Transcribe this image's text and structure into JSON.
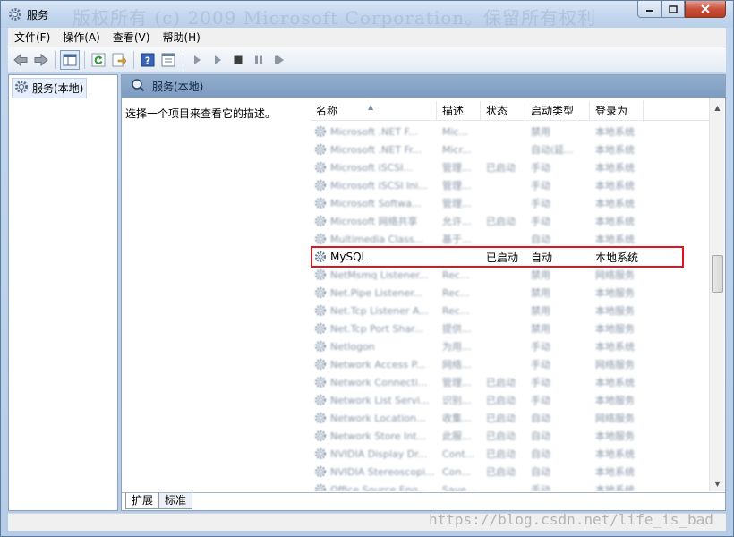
{
  "window": {
    "title": "服务",
    "watermark_top": "版权所有 (c) 2009 Microsoft Corporation。保留所有权利"
  },
  "menubar": {
    "items": [
      "文件(F)",
      "操作(A)",
      "查看(V)",
      "帮助(H)"
    ]
  },
  "toolbar": {
    "icons": [
      "back-arrow-icon",
      "forward-arrow-icon",
      "show-hide-tree-icon",
      "refresh-icon",
      "export-icon",
      "help-icon",
      "properties-icon",
      "start-service-icon",
      "start-service-alt-icon",
      "stop-service-icon",
      "pause-service-icon",
      "restart-service-icon"
    ]
  },
  "tree": {
    "root_label": "服务(本地)"
  },
  "main": {
    "header": "服务(本地)",
    "description_hint": "选择一个项目来查看它的描述。",
    "columns": {
      "name": "名称",
      "description": "描述",
      "status": "状态",
      "startup": "启动类型",
      "logon": "登录为"
    },
    "blurred_rows_before": [
      {
        "name": "Microsoft .NET F...",
        "desc": "Mic...",
        "status": "",
        "startup": "禁用",
        "logon": "本地系统"
      },
      {
        "name": "Microsoft .NET Fr...",
        "desc": "Micr...",
        "status": "",
        "startup": "自动(延...",
        "logon": "本地系统"
      },
      {
        "name": "Microsoft iSCSI...",
        "desc": "管理...",
        "status": "已启动",
        "startup": "手动",
        "logon": "本地系统"
      },
      {
        "name": "Microsoft iSCSI Ini...",
        "desc": "管理...",
        "status": "",
        "startup": "手动",
        "logon": "本地系统"
      },
      {
        "name": "Microsoft Softwa...",
        "desc": "管理...",
        "status": "",
        "startup": "手动",
        "logon": "本地系统"
      },
      {
        "name": "Microsoft 网络共享",
        "desc": "允许...",
        "status": "已启动",
        "startup": "手动",
        "logon": "本地系统"
      },
      {
        "name": "Multimedia Class...",
        "desc": "基于...",
        "status": "",
        "startup": "自动",
        "logon": "本地系统"
      }
    ],
    "highlight_row": {
      "name": "MySQL",
      "desc": "",
      "status": "已启动",
      "startup": "自动",
      "logon": "本地系统"
    },
    "blurred_rows_after": [
      {
        "name": "NetMsmq Listener...",
        "desc": "Rec...",
        "status": "",
        "startup": "禁用",
        "logon": "网络服务"
      },
      {
        "name": "Net.Pipe Listener...",
        "desc": "Rec...",
        "status": "",
        "startup": "禁用",
        "logon": "本地服务"
      },
      {
        "name": "Net.Tcp Listener A...",
        "desc": "Rec...",
        "status": "",
        "startup": "禁用",
        "logon": "本地服务"
      },
      {
        "name": "Net.Tcp Port Shar...",
        "desc": "提供...",
        "status": "",
        "startup": "禁用",
        "logon": "本地服务"
      },
      {
        "name": "Netlogon",
        "desc": "为用...",
        "status": "",
        "startup": "手动",
        "logon": "本地系统"
      },
      {
        "name": "Network Access P...",
        "desc": "网络...",
        "status": "",
        "startup": "手动",
        "logon": "网络服务"
      },
      {
        "name": "Network Connecti...",
        "desc": "管理...",
        "status": "已启动",
        "startup": "手动",
        "logon": "本地系统"
      },
      {
        "name": "Network List Servi...",
        "desc": "识别...",
        "status": "已启动",
        "startup": "手动",
        "logon": "本地服务"
      },
      {
        "name": "Network Location...",
        "desc": "收集...",
        "status": "已启动",
        "startup": "自动",
        "logon": "网络服务"
      },
      {
        "name": "Network Store Int...",
        "desc": "此服...",
        "status": "已启动",
        "startup": "自动",
        "logon": "本地服务"
      },
      {
        "name": "NVIDIA Display Dr...",
        "desc": "Cont...",
        "status": "已启动",
        "startup": "自动",
        "logon": "本地系统"
      },
      {
        "name": "NVIDIA Stereoscopi...",
        "desc": "Con...",
        "status": "已启动",
        "startup": "自动",
        "logon": "本地系统"
      },
      {
        "name": "Office Source Eng...",
        "desc": "Save...",
        "status": "",
        "startup": "手动",
        "logon": "本地系统"
      }
    ],
    "tabs": [
      "扩展",
      "标准"
    ]
  },
  "statusbar": {
    "watermark": "https://blog.csdn.net/life_is_bad"
  },
  "colors": {
    "highlight_border": "#e0141e",
    "header_bg": "#7c9bc0"
  }
}
